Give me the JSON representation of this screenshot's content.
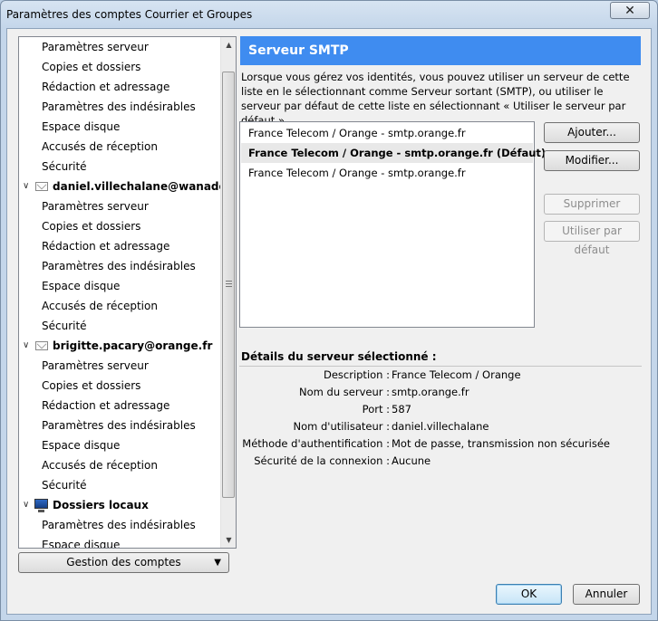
{
  "window": {
    "title": "Paramètres des comptes Courrier et Groupes",
    "close_label": "✕"
  },
  "tree": {
    "rows": [
      {
        "label": "Paramètres serveur"
      },
      {
        "label": "Copies et dossiers"
      },
      {
        "label": "Rédaction et adressage"
      },
      {
        "label": "Paramètres des indésirables"
      },
      {
        "label": "Espace disque"
      },
      {
        "label": "Accusés de réception"
      },
      {
        "label": "Sécurité"
      },
      {
        "label": "daniel.villechalane@wanadoo.fr"
      },
      {
        "label": "Paramètres serveur"
      },
      {
        "label": "Copies et dossiers"
      },
      {
        "label": "Rédaction et adressage"
      },
      {
        "label": "Paramètres des indésirables"
      },
      {
        "label": "Espace disque"
      },
      {
        "label": "Accusés de réception"
      },
      {
        "label": "Sécurité"
      },
      {
        "label": "brigitte.pacary@orange.fr"
      },
      {
        "label": "Paramètres serveur"
      },
      {
        "label": "Copies et dossiers"
      },
      {
        "label": "Rédaction et adressage"
      },
      {
        "label": "Paramètres des indésirables"
      },
      {
        "label": "Espace disque"
      },
      {
        "label": "Accusés de réception"
      },
      {
        "label": "Sécurité"
      },
      {
        "label": "Dossiers locaux"
      },
      {
        "label": "Paramètres des indésirables"
      },
      {
        "label": "Espace disque"
      }
    ]
  },
  "manage_button": {
    "label": "Gestion des comptes"
  },
  "smtp": {
    "header": "Serveur SMTP",
    "description": "Lorsque vous gérez vos identités, vous pouvez utiliser un serveur de cette liste en le sélectionnant comme Serveur sortant (SMTP), ou utiliser le serveur par défaut de cette liste en sélectionnant « Utiliser le serveur par défaut ».",
    "servers": [
      {
        "label": "France Telecom / Orange - smtp.orange.fr"
      },
      {
        "label": "France Telecom / Orange - smtp.orange.fr (Défaut)"
      },
      {
        "label": "France Telecom / Orange - smtp.orange.fr"
      }
    ],
    "buttons": {
      "add": "Ajouter...",
      "edit": "Modifier...",
      "remove": "Supprimer",
      "set_default": "Utiliser par défaut"
    }
  },
  "details": {
    "title": "Détails du serveur sélectionné :",
    "rows": [
      {
        "label": "Description :",
        "value": "France Telecom / Orange"
      },
      {
        "label": "Nom du serveur :",
        "value": "smtp.orange.fr"
      },
      {
        "label": "Port :",
        "value": "587"
      },
      {
        "label": "Nom d'utilisateur :",
        "value": "daniel.villechalane"
      },
      {
        "label": "Méthode d'authentification :",
        "value": "Mot de passe, transmission non sécurisée"
      },
      {
        "label": "Sécurité de la connexion :",
        "value": "Aucune"
      }
    ]
  },
  "footer": {
    "ok": "OK",
    "cancel": "Annuler"
  }
}
